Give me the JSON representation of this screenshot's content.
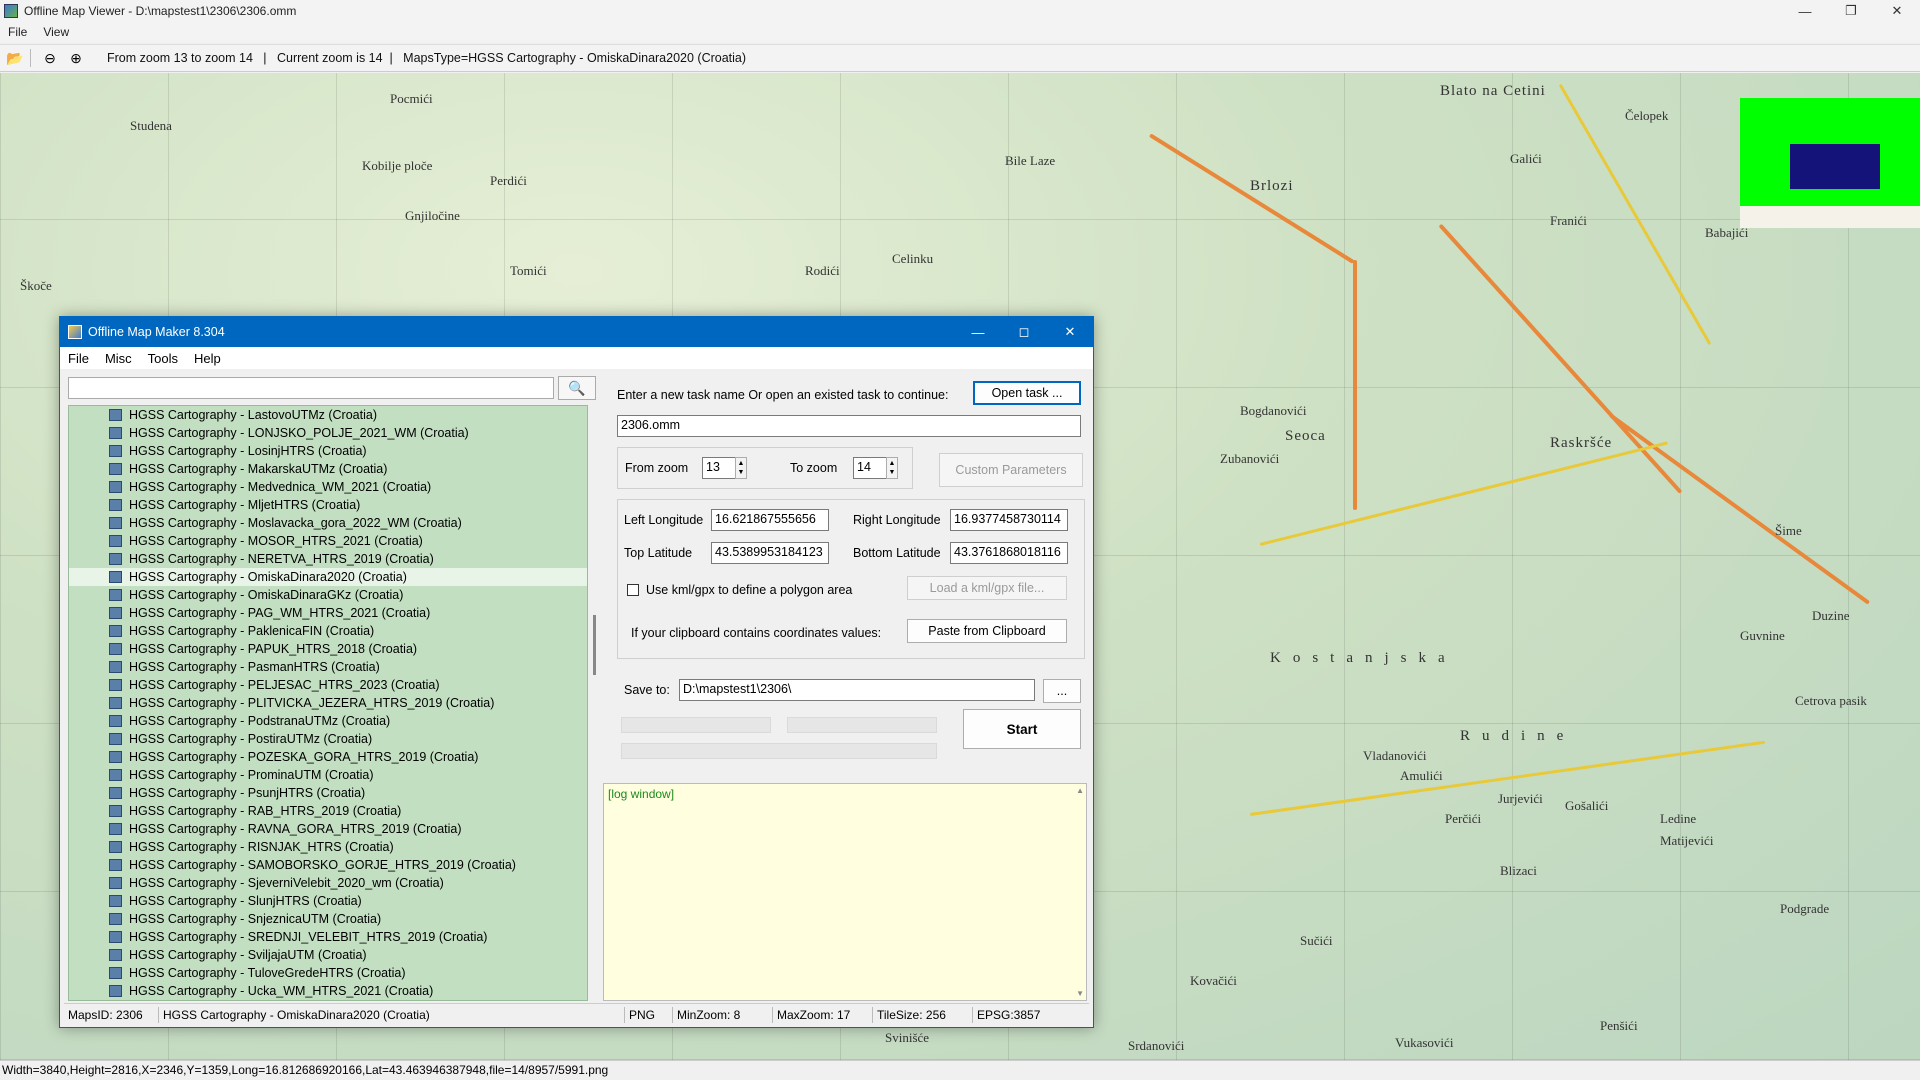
{
  "viewer": {
    "title": "Offline Map Viewer - D:\\mapstest1\\2306\\2306.omm",
    "menu": [
      "File",
      "View"
    ],
    "toolbar_info": "From zoom 13 to zoom 14   |   Current zoom is 14  |   MapsType=HGSS Cartography - OmiskaDinara2020 (Croatia)",
    "status": "Width=3840,Height=2816,X=2346,Y=1359,Long=16.812686920166,Lat=43.463946387948,file=14/8957/5991.png",
    "map_places": [
      "Pocmići",
      "Studena",
      "Kobilje ploče",
      "Perdići",
      "Gnjiločine",
      "Tomići",
      "Rodići",
      "Bile Laze",
      "Celinku",
      "Brlozi",
      "Blato na Cetini",
      "Čelopek",
      "Galići",
      "Franići",
      "Babajići",
      "Seoca",
      "Zubanovići",
      "Raskršće",
      "Kostanjska",
      "Rudine",
      "Vladanovići",
      "Amulići",
      "Ledine",
      "Matijevići",
      "Duzine",
      "Guvnine",
      "Cetrova pasik",
      "Podgrade",
      "Svinišće",
      "Penšići",
      "Kovačići",
      "Sučići",
      "Šime",
      "Škoče",
      "Bogdanovići",
      "Jurjevići",
      "Perčići",
      "Gošalići",
      "Blizaci",
      "Vukasovići",
      "Srdanovići"
    ]
  },
  "maker": {
    "title": "Offline Map Maker 8.304",
    "menu": [
      "File",
      "Misc",
      "Tools",
      "Help"
    ],
    "search_placeholder": "",
    "map_list": [
      "HGSS Cartography - LastovoUTMz (Croatia)",
      "HGSS Cartography - LONJSKO_POLJE_2021_WM (Croatia)",
      "HGSS Cartography - LosinjHTRS (Croatia)",
      "HGSS Cartography - MakarskaUTMz (Croatia)",
      "HGSS Cartography - Medvednica_WM_2021 (Croatia)",
      "HGSS Cartography - MljetHTRS (Croatia)",
      "HGSS Cartography - Moslavacka_gora_2022_WM (Croatia)",
      "HGSS Cartography - MOSOR_HTRS_2021 (Croatia)",
      "HGSS Cartography - NERETVA_HTRS_2019 (Croatia)",
      "HGSS Cartography - OmiskaDinara2020 (Croatia)",
      "HGSS Cartography - OmiskaDinaraGKz (Croatia)",
      "HGSS Cartography - PAG_WM_HTRS_2021 (Croatia)",
      "HGSS Cartography - PaklenicaFIN (Croatia)",
      "HGSS Cartography - PAPUK_HTRS_2018 (Croatia)",
      "HGSS Cartography - PasmanHTRS (Croatia)",
      "HGSS Cartography - PELJESAC_HTRS_2023 (Croatia)",
      "HGSS Cartography - PLITVICKA_JEZERA_HTRS_2019 (Croatia)",
      "HGSS Cartography - PodstranaUTMz (Croatia)",
      "HGSS Cartography - PostiraUTMz (Croatia)",
      "HGSS Cartography - POZESKA_GORA_HTRS_2019 (Croatia)",
      "HGSS Cartography - ProminaUTM (Croatia)",
      "HGSS Cartography - PsunjHTRS (Croatia)",
      "HGSS Cartography - RAB_HTRS_2019 (Croatia)",
      "HGSS Cartography - RAVNA_GORA_HTRS_2019 (Croatia)",
      "HGSS Cartography - RISNJAK_HTRS (Croatia)",
      "HGSS Cartography - SAMOBORSKO_GORJE_HTRS_2019 (Croatia)",
      "HGSS Cartography - SjeverniVelebit_2020_wm (Croatia)",
      "HGSS Cartography - SlunjHTRS (Croatia)",
      "HGSS Cartography - SnjeznicaUTM (Croatia)",
      "HGSS Cartography - SREDNJI_VELEBIT_HTRS_2019 (Croatia)",
      "HGSS Cartography - SviljajaUTM (Croatia)",
      "HGSS Cartography - TuloveGredeHTRS (Croatia)",
      "HGSS Cartography - Ucka_WM_HTRS_2021 (Croatia)"
    ],
    "selected_index": 9,
    "task_prompt": "Enter a new task name Or open an existed task to continue:",
    "open_task_label": "Open task ...",
    "task_name": "2306.omm",
    "from_zoom_label": "From zoom",
    "from_zoom": "13",
    "to_zoom_label": "To zoom",
    "to_zoom": "14",
    "custom_params_label": "Custom Parameters",
    "left_lon_label": "Left Longitude",
    "left_lon": "16.621867555656",
    "right_lon_label": "Right Longitude",
    "right_lon": "16.9377458730114",
    "top_lat_label": "Top Latitude",
    "top_lat": "43.5389953184123",
    "bottom_lat_label": "Bottom Latitude",
    "bottom_lat": "43.3761868018116",
    "kml_label": "Use kml/gpx to define a polygon area",
    "load_kml_label": "Load a kml/gpx file...",
    "clipboard_prompt": "If your clipboard contains coordinates values:",
    "paste_label": "Paste from Clipboard",
    "save_to_label": "Save to:",
    "save_to": "D:\\mapstest1\\2306\\",
    "browse_label": "...",
    "start_label": "Start",
    "log_text": "[log window]",
    "status": {
      "maps_id": "MapsID: 2306",
      "maps_name": "HGSS Cartography - OmiskaDinara2020 (Croatia)",
      "format": "PNG",
      "min_zoom": "MinZoom: 8",
      "max_zoom": "MaxZoom: 17",
      "tile_size": "TileSize: 256",
      "epsg": "EPSG:3857"
    }
  },
  "colors": {
    "accent": "#0067c0",
    "list_bg": "#c2dfc2",
    "log_bg": "#ffffe0",
    "minimap_bg": "#00ff00",
    "minimap_view": "#14137a"
  }
}
